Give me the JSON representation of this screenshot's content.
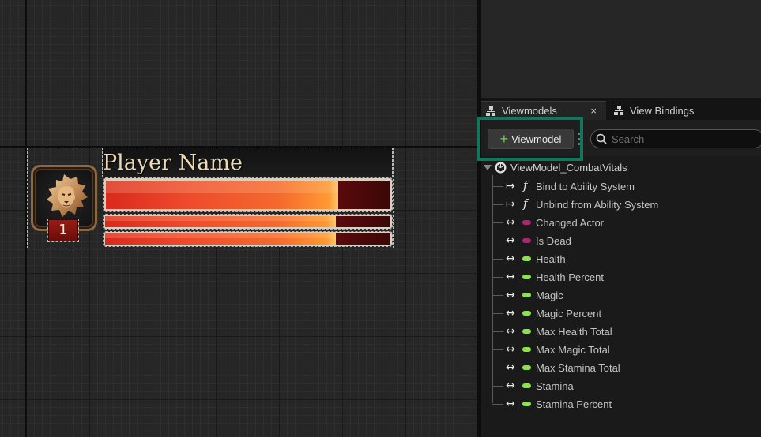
{
  "canvas": {
    "widget": {
      "player_name": "Player Name",
      "level": "1",
      "bars": {
        "health_fill": 0.82,
        "magic_fill": 0.81,
        "stamina_fill": 0.81
      }
    }
  },
  "panel": {
    "tabs": [
      {
        "label": "Viewmodels",
        "active": true,
        "icon": "hierarchy-icon"
      },
      {
        "label": "View Bindings",
        "active": false,
        "icon": "hierarchy-icon"
      }
    ],
    "close_glyph": "×",
    "toolbar": {
      "add_viewmodel_label": "Viewmodel",
      "search_placeholder": "Search"
    },
    "tree": {
      "root": "ViewModel_CombatVitals",
      "items": [
        {
          "label": "Bind to Ability System",
          "kind": "function"
        },
        {
          "label": "Unbind from Ability System",
          "kind": "function"
        },
        {
          "label": "Changed Actor",
          "kind": "property",
          "color": "#a8276e"
        },
        {
          "label": "Is Dead",
          "kind": "property",
          "color": "#a8276e"
        },
        {
          "label": "Health",
          "kind": "property",
          "color": "#8be34a"
        },
        {
          "label": "Health Percent",
          "kind": "property",
          "color": "#8be34a"
        },
        {
          "label": "Magic",
          "kind": "property",
          "color": "#8be34a"
        },
        {
          "label": "Magic Percent",
          "kind": "property",
          "color": "#8be34a"
        },
        {
          "label": "Max Health Total",
          "kind": "property",
          "color": "#8be34a"
        },
        {
          "label": "Max Magic Total",
          "kind": "property",
          "color": "#8be34a"
        },
        {
          "label": "Max Stamina Total",
          "kind": "property",
          "color": "#8be34a"
        },
        {
          "label": "Stamina",
          "kind": "property",
          "color": "#8be34a"
        },
        {
          "label": "Stamina Percent",
          "kind": "property",
          "color": "#8be34a"
        }
      ]
    }
  },
  "colors": {
    "highlight": "#10785a",
    "plus": "#6ad13e"
  }
}
